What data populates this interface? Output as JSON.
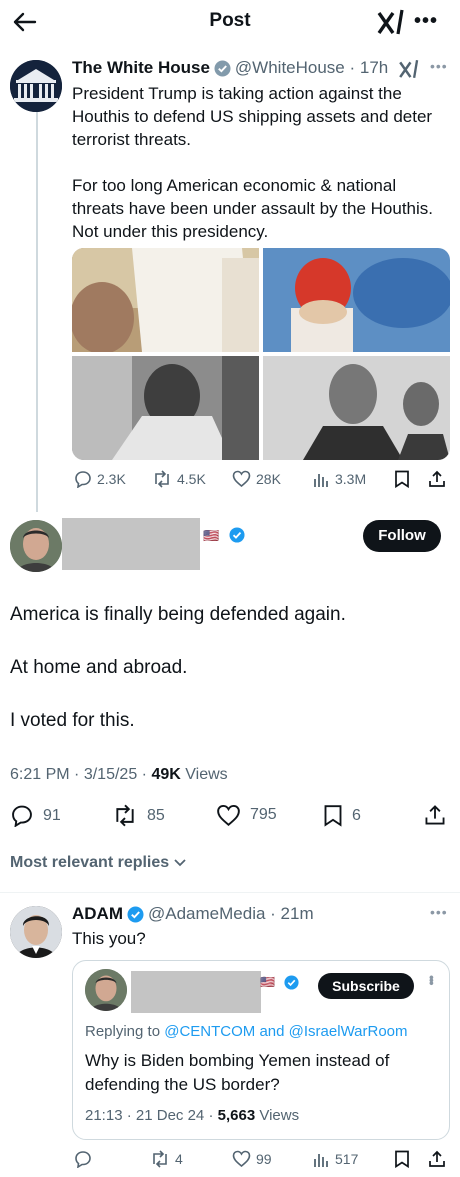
{
  "header": {
    "title": "Post"
  },
  "original_post": {
    "author_name": "The White House",
    "handle": "@WhiteHouse",
    "time": "17h",
    "paragraphs": [
      "President Trump is taking action against the Houthis to defend US shipping assets and deter terrorist threats.",
      "For too long American economic & national threats have been under assault by the Houthis. Not under this presidency."
    ],
    "stats": {
      "replies": "2.3K",
      "reposts": "4.5K",
      "likes": "28K",
      "views": "3.3M"
    }
  },
  "main_post": {
    "flag": "🇺🇸",
    "follow_label": "Follow",
    "paragraphs": [
      "America is finally being defended again.",
      "At home and abroad.",
      "I voted for this."
    ],
    "time": "6:21 PM",
    "date": "3/15/25",
    "views_count": "49K",
    "views_label": "Views",
    "actions": {
      "replies": "91",
      "reposts": "85",
      "likes": "795",
      "bookmarks": "6"
    }
  },
  "replies_filter": "Most relevant replies",
  "reply": {
    "author_name": "ADAM",
    "handle": "@AdameMedia",
    "time": "21m",
    "text": "This you?",
    "quote": {
      "flag": "🇺🇸",
      "subscribe_label": "Subscribe",
      "replying_prefix": "Replying to",
      "replying_user1": "@CENTCOM",
      "replying_and": "and",
      "replying_user2": "@IsraelWarRoom",
      "text": "Why is Biden bombing Yemen instead of defending the US border?",
      "time": "21:13",
      "date": "21 Dec 24",
      "views_count": "5,663",
      "views_label": "Views"
    },
    "stats": {
      "replies": "",
      "reposts": "4",
      "likes": "99",
      "views": "517"
    }
  },
  "colors": {
    "accent": "#1d9bf0",
    "text": "#0f1419",
    "muted": "#536471",
    "border": "#cfd9de"
  }
}
